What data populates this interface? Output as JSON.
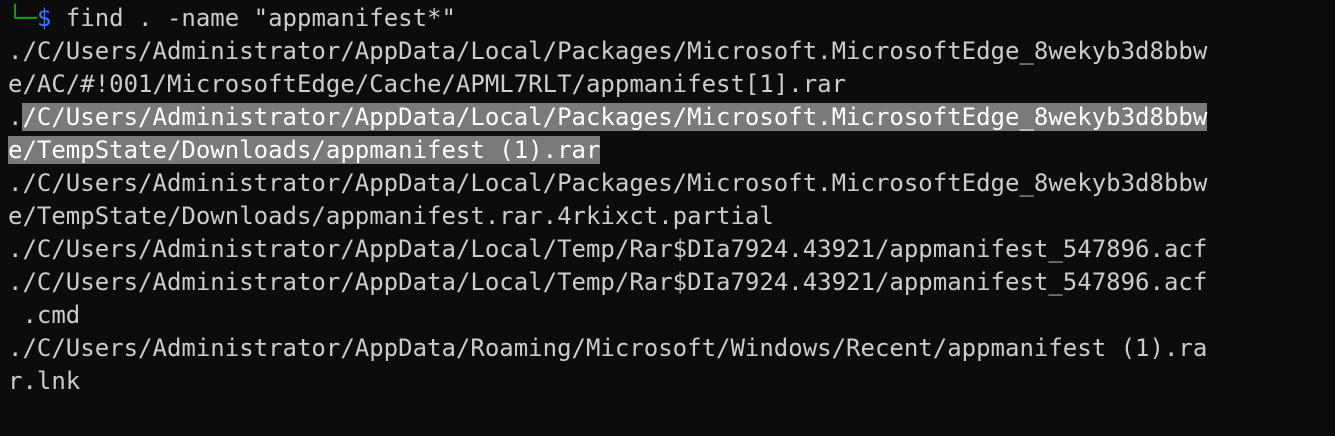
{
  "prompt": {
    "branch": "└─",
    "symbol": "$",
    "command": " find . -name \"appmanifest*\""
  },
  "output": [
    "./C/Users/Administrator/AppData/Local/Packages/Microsoft.MicrosoftEdge_8wekyb3d8bbw",
    "e/AC/#!001/MicrosoftEdge/Cache/APML7RLT/appmanifest[1].rar",
    {
      "plain": ".",
      "selected": "/C/Users/Administrator/AppData/Local/Packages/Microsoft.MicrosoftEdge_8wekyb3d8bbw"
    },
    {
      "plain": "",
      "selected": "e/TempState/Downloads/appmanifest (1).rar"
    },
    "./C/Users/Administrator/AppData/Local/Packages/Microsoft.MicrosoftEdge_8wekyb3d8bbw",
    "e/TempState/Downloads/appmanifest.rar.4rkixct.partial",
    "./C/Users/Administrator/AppData/Local/Temp/Rar$DIa7924.43921/appmanifest_547896.acf",
    "./C/Users/Administrator/AppData/Local/Temp/Rar$DIa7924.43921/appmanifest_547896.acf",
    " .cmd",
    "./C/Users/Administrator/AppData/Roaming/Microsoft/Windows/Recent/appmanifest (1).ra",
    "r.lnk"
  ]
}
